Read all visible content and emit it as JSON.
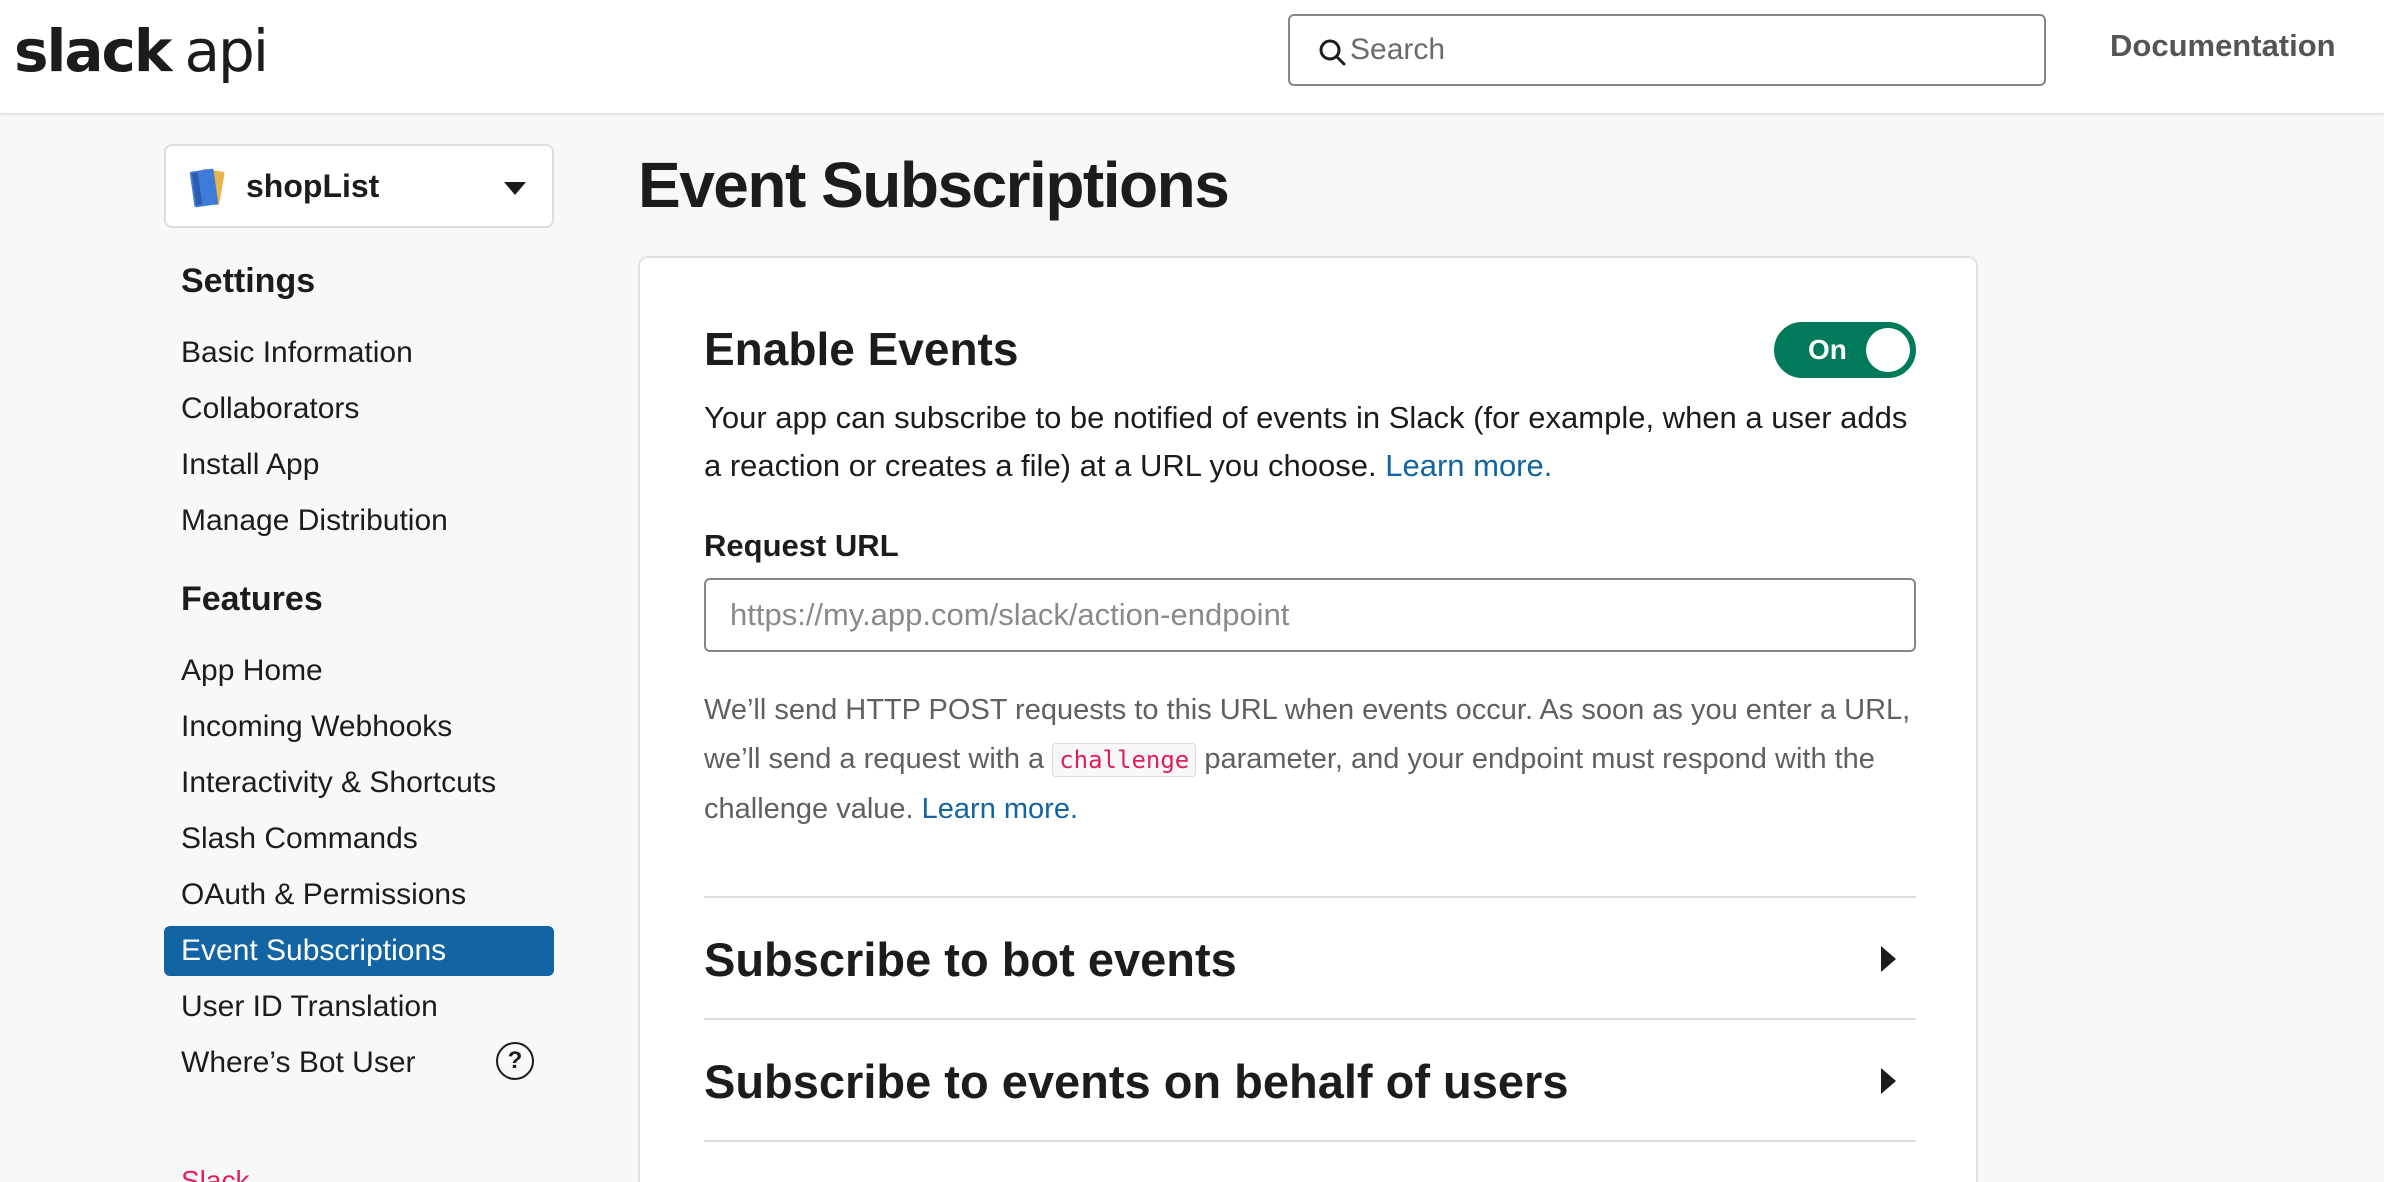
{
  "header": {
    "logo_bold": "slack",
    "logo_light": "api",
    "search_placeholder": "Search",
    "documentation_label": "Documentation"
  },
  "app_selector": {
    "name": "shopList"
  },
  "sidebar": {
    "settings_heading": "Settings",
    "settings_items": [
      {
        "label": "Basic Information"
      },
      {
        "label": "Collaborators"
      },
      {
        "label": "Install App"
      },
      {
        "label": "Manage Distribution"
      }
    ],
    "features_heading": "Features",
    "features_items": [
      {
        "label": "App Home"
      },
      {
        "label": "Incoming Webhooks"
      },
      {
        "label": "Interactivity & Shortcuts"
      },
      {
        "label": "Slash Commands"
      },
      {
        "label": "OAuth & Permissions"
      },
      {
        "label": "Event Subscriptions",
        "active": true
      },
      {
        "label": "User ID Translation"
      },
      {
        "label": "Where’s Bot User"
      }
    ],
    "help_icon_glyph": "?",
    "footer_text": "Slack"
  },
  "main": {
    "page_title": "Event Subscriptions",
    "enable_events": {
      "title": "Enable Events",
      "toggle_label": "On",
      "toggle_on": true,
      "description": "Your app can subscribe to be notified of events in Slack (for example, when a user adds a reaction or creates a file) at a URL you choose.",
      "learn_more": "Learn more."
    },
    "request_url": {
      "label": "Request URL",
      "placeholder": "https://my.app.com/slack/action-endpoint",
      "value": "",
      "help_before": "We’ll send HTTP POST requests to this URL when events occur. As soon as you enter a URL, we’ll send a request with a",
      "help_code": "challenge",
      "help_after": "parameter, and your endpoint must respond with the challenge value.",
      "learn_more": "Learn more."
    },
    "sections": [
      {
        "title": "Subscribe to bot events"
      },
      {
        "title": "Subscribe to events on behalf of users"
      }
    ]
  },
  "colors": {
    "accent_blue": "#1264a3",
    "toggle_green": "#007a5a",
    "code_red": "#e01e5a"
  },
  "icons": {
    "search": "magnifier-icon",
    "app": "notebook-icon",
    "dropdown": "caret-down-icon",
    "expand": "caret-right-icon",
    "help": "question-circle-icon"
  }
}
